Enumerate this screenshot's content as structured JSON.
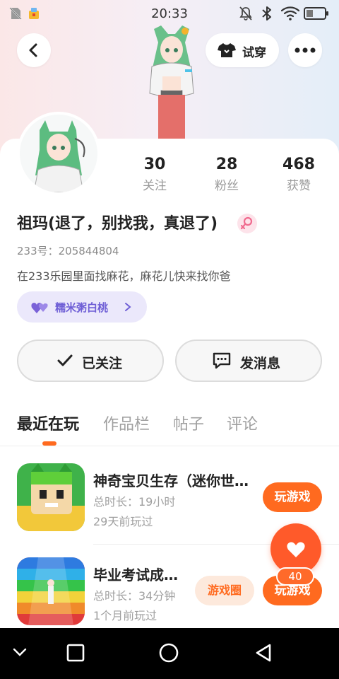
{
  "status_bar": {
    "time": "20:33"
  },
  "header": {
    "try_on_label": "试穿"
  },
  "profile": {
    "stats": [
      {
        "count": "30",
        "label": "关注"
      },
      {
        "count": "28",
        "label": "粉丝"
      },
      {
        "count": "468",
        "label": "获赞"
      }
    ],
    "name": "祖玛(退了，别找我，真退了)",
    "uid": "233号：205844804",
    "bio": "在233乐园里面找麻花，麻花儿快来找你爸",
    "relationship_tag": "糯米粥白桃",
    "follow_button": "已关注",
    "message_button": "发消息"
  },
  "tabs": [
    "最近在玩",
    "作品栏",
    "帖子",
    "评论"
  ],
  "games": [
    {
      "title": "神奇宝贝生存（迷你世…",
      "playtime": "总时长：19小时",
      "last_played": "29天前玩过",
      "play_label": "玩游戏"
    },
    {
      "title": "毕业考试成…",
      "playtime": "总时长：34分钟",
      "last_played": "1个月前玩过",
      "circle_label": "游戏圈",
      "play_label": "玩游戏"
    }
  ],
  "like_count": "40",
  "colors": {
    "accent": "#ff6a1f",
    "tag_text": "#6f5fd6",
    "tag_bg": "#ebe8fb"
  },
  "icons": {
    "status_left": [
      "no-sim-icon",
      "app-notification-icon"
    ],
    "status_right": [
      "mute-icon",
      "bluetooth-icon",
      "wifi-icon",
      "battery-icon"
    ],
    "nav": [
      "collapse-icon",
      "recents-icon",
      "home-icon",
      "back-icon"
    ]
  }
}
